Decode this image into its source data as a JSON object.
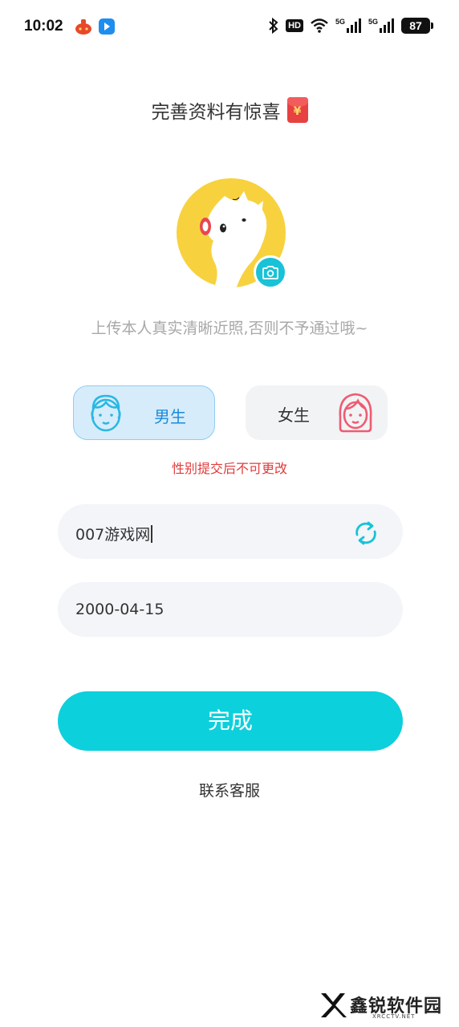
{
  "status_bar": {
    "time": "10:02",
    "hd_label": "HD",
    "network_1": "5G",
    "network_2": "5G",
    "battery": "87"
  },
  "header": {
    "title": "完善资料有惊喜",
    "badge_icon": "red-packet-icon",
    "badge_symbol": "¥"
  },
  "avatar": {
    "icon": "squirrel-moon-avatar",
    "camera_icon": "camera-icon",
    "hint": "上传本人真实清晰近照,否则不予通过哦~"
  },
  "gender": {
    "selected": "male",
    "male_label": "男生",
    "female_label": "女生",
    "note": "性别提交后不可更改"
  },
  "form": {
    "nickname_value": "007游戏网",
    "birthday_value": "2000-04-15",
    "refresh_icon": "refresh-icon"
  },
  "actions": {
    "submit_label": "完成",
    "contact_label": "联系客服"
  },
  "colors": {
    "accent": "#0cd0dc",
    "male_bg": "#d6ecfb",
    "male_text": "#1a8bd8",
    "warning": "#e23b3b",
    "avatar_yellow": "#f7d23e"
  },
  "watermark": {
    "text": "鑫锐软件园",
    "sub": "XRCCTV.NET"
  }
}
